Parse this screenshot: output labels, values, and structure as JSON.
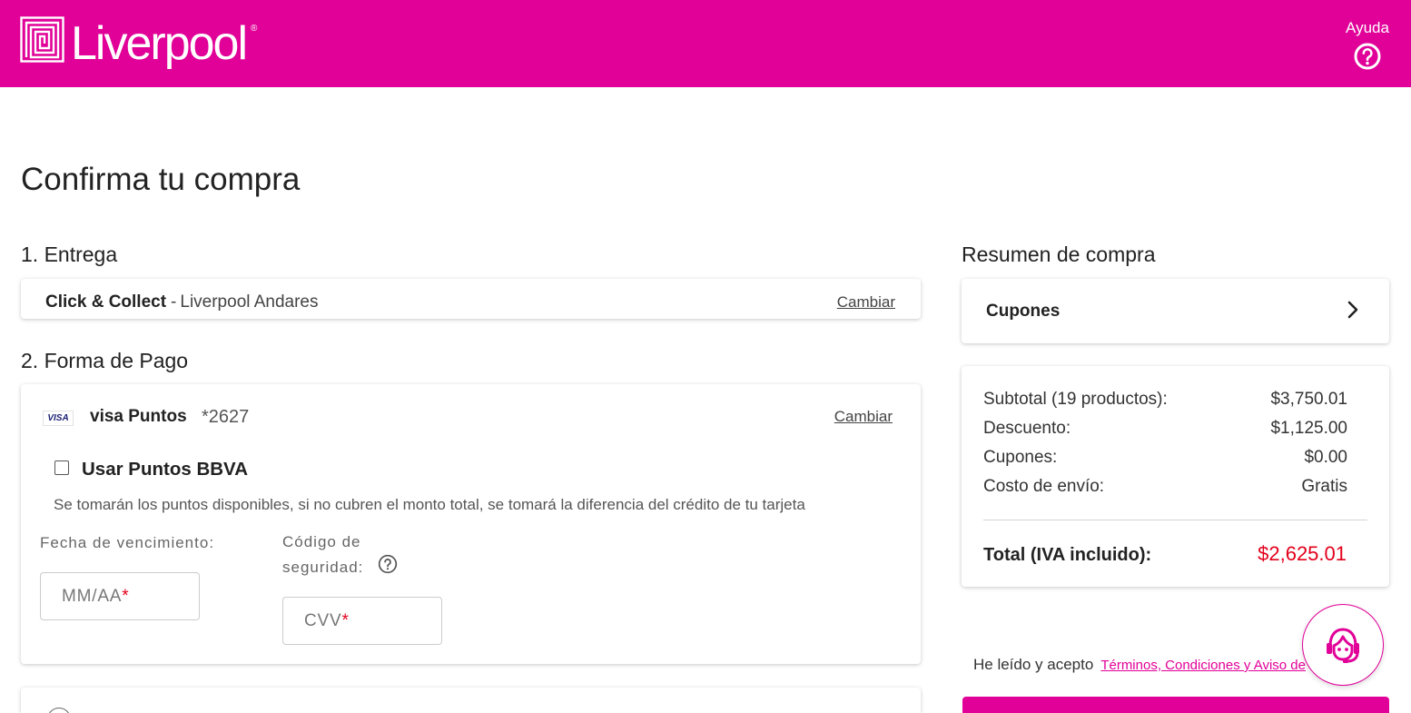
{
  "header": {
    "brand": "Liverpool",
    "brand_mark": "®",
    "logo_icon": "liverpool-logo-icon",
    "help_label": "Ayuda",
    "help_icon": "question-circle-icon"
  },
  "colors": {
    "brand_magenta": "#E10098",
    "total_red": "#E3001B",
    "text": "#333333"
  },
  "page": {
    "title": "Confirma tu compra"
  },
  "delivery": {
    "heading": "1. Entrega",
    "method": "Click & Collect",
    "separator": "-",
    "store": "Liverpool Andares",
    "change_label": "Cambiar"
  },
  "payment": {
    "heading": "2. Forma de Pago",
    "card_logo": "VISA",
    "card_name": "visa Puntos",
    "card_number": "*2627",
    "change_label": "Cambiar",
    "points_checkbox_label": "Usar Puntos BBVA",
    "points_checked": false,
    "points_note": "Se tomarán los puntos disponibles, si no cubren el monto total, se tomará la diferencia del crédito de tu tarjeta",
    "expiry_label": "Fecha de vencimiento:",
    "expiry_placeholder": "MM/AA",
    "cvv_label": "Código de seguridad:",
    "cvv_placeholder": "CVV",
    "cvv_help_icon": "question-circle-icon",
    "required_mark": "*"
  },
  "next_payment_option": {
    "icon": "radio-button-icon"
  },
  "summary": {
    "heading": "Resumen de compra",
    "coupons": {
      "label": "Cupones",
      "icon": "chevron-right-icon"
    },
    "rows": [
      {
        "label": "Subtotal (19 productos):",
        "value": "$3,750.01"
      },
      {
        "label": "Descuento:",
        "value": "$1,125.00"
      },
      {
        "label": "Cupones:",
        "value": "$0.00"
      },
      {
        "label": "Costo de envío:",
        "value": "Gratis"
      }
    ],
    "total": {
      "label": "Total (IVA incluido):",
      "value": "$2,625.01"
    }
  },
  "terms": {
    "prefix": "He leído y acepto",
    "link": "Términos, Condiciones y Aviso de"
  },
  "chat": {
    "icon": "customer-support-agent-icon"
  }
}
